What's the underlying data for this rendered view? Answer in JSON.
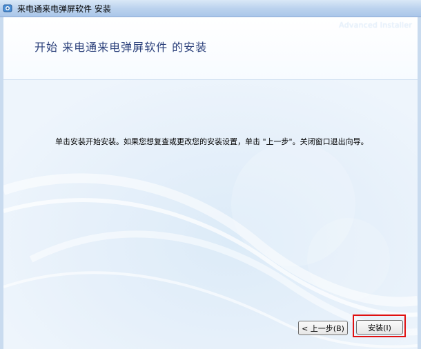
{
  "window": {
    "title": "来电通来电弹屏软件 安装"
  },
  "header": {
    "brand": "Advanced Installer",
    "title": "开始 来电通来电弹屏软件 的安装"
  },
  "content": {
    "instruction": "单击安装开始安装。如果您想复查或更改您的安装设置，单击 \"上一步\"。关闭窗口退出向导。"
  },
  "buttons": {
    "back_label": "< 上一步(B)",
    "install_label": "安装(I)"
  },
  "colors": {
    "highlight": "#e01010",
    "title": "#2a3f7a"
  }
}
